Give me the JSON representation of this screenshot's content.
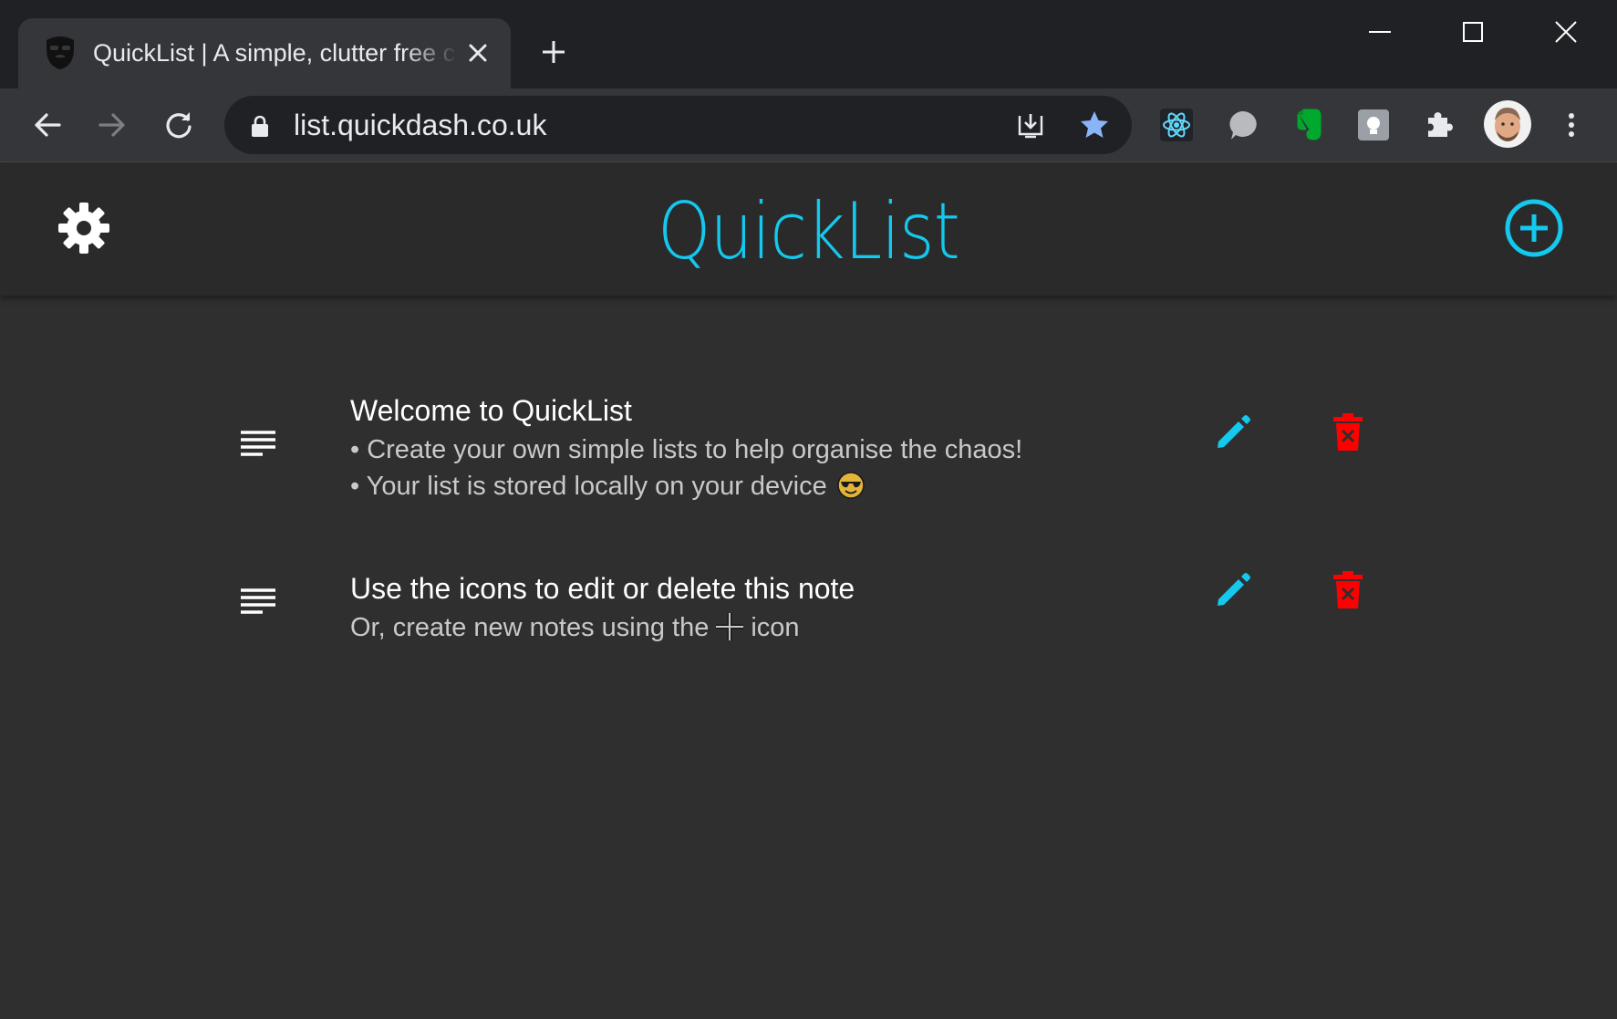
{
  "browser": {
    "tab_title": "QuickList | A simple, clutter free c",
    "url": "list.quickdash.co.uk"
  },
  "app": {
    "title": "QuickList",
    "accent_color": "#14c8ee",
    "delete_color": "#ff0000"
  },
  "notes": [
    {
      "title": "Welcome to QuickList",
      "lines": [
        "• Create your own simple lists to help organise the chaos!",
        "• Your list is stored locally on your device"
      ]
    },
    {
      "title": "Use the icons to edit or delete this note",
      "line_before_icon": "Or, create new notes using the",
      "line_after_icon": "icon"
    }
  ]
}
